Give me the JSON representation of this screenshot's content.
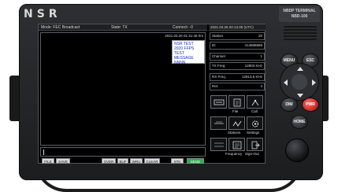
{
  "device": {
    "brand": "NSR",
    "model_line1": "NBDP TERMINAL",
    "model_line2": "NBD-100"
  },
  "header": {
    "mode": "Mode: FEC Broadcast",
    "state": "State: TX",
    "connect": "Connect: -0"
  },
  "message": {
    "timestamp": "2021.03.26 01:41:46 hrs",
    "lines": [
      "NSR TEST",
      "2020 FFPS",
      "TEST MESSAGE",
      "NNNN"
    ]
  },
  "status_panel": {
    "header": "2021.03.26 02:13.00 (UTC)",
    "rows": [
      {
        "key": "Station",
        "value": "20"
      },
      {
        "key": "ID",
        "value": "414888888"
      },
      {
        "key": "Channel",
        "value": "1"
      },
      {
        "key": "TX Freq.",
        "value": "12803 KHz"
      },
      {
        "key": "RX Freq.",
        "value": "12813.5 KHz"
      },
      {
        "key": "Ret.",
        "value": "4"
      }
    ],
    "icon_buttons": [
      {
        "icon": "arq-icon",
        "label": ""
      },
      {
        "icon": "file-icon",
        "label": "File"
      },
      {
        "icon": "call-icon",
        "label": "Call"
      },
      {
        "icon": "rf-icon",
        "label": ""
      },
      {
        "icon": "stations-icon",
        "label": "Stations"
      },
      {
        "icon": "settings-icon",
        "label": "Settings"
      },
      {
        "icon": "nbdp-icon",
        "label": ""
      },
      {
        "icon": "frequency-icon",
        "label": "Frequency"
      },
      {
        "icon": "sign-out-icon",
        "label": "Sign-Out"
      }
    ]
  },
  "bottom_buttons": {
    "file": "FILE",
    "save": "SAVE",
    "over": "OVER",
    "buf": "BUF",
    "wru": "WRU",
    "clear": "CLEAR",
    "stk": "STK",
    "send": "SEND"
  },
  "hardware_keys": {
    "menu": "MENU",
    "esc": "ESC",
    "dim": "DIM",
    "pwr": "PWR",
    "home": "HOME"
  },
  "colors": {
    "send_active": "#28b04a",
    "pwr": "#c0261f",
    "message_text": "#1230b8"
  }
}
